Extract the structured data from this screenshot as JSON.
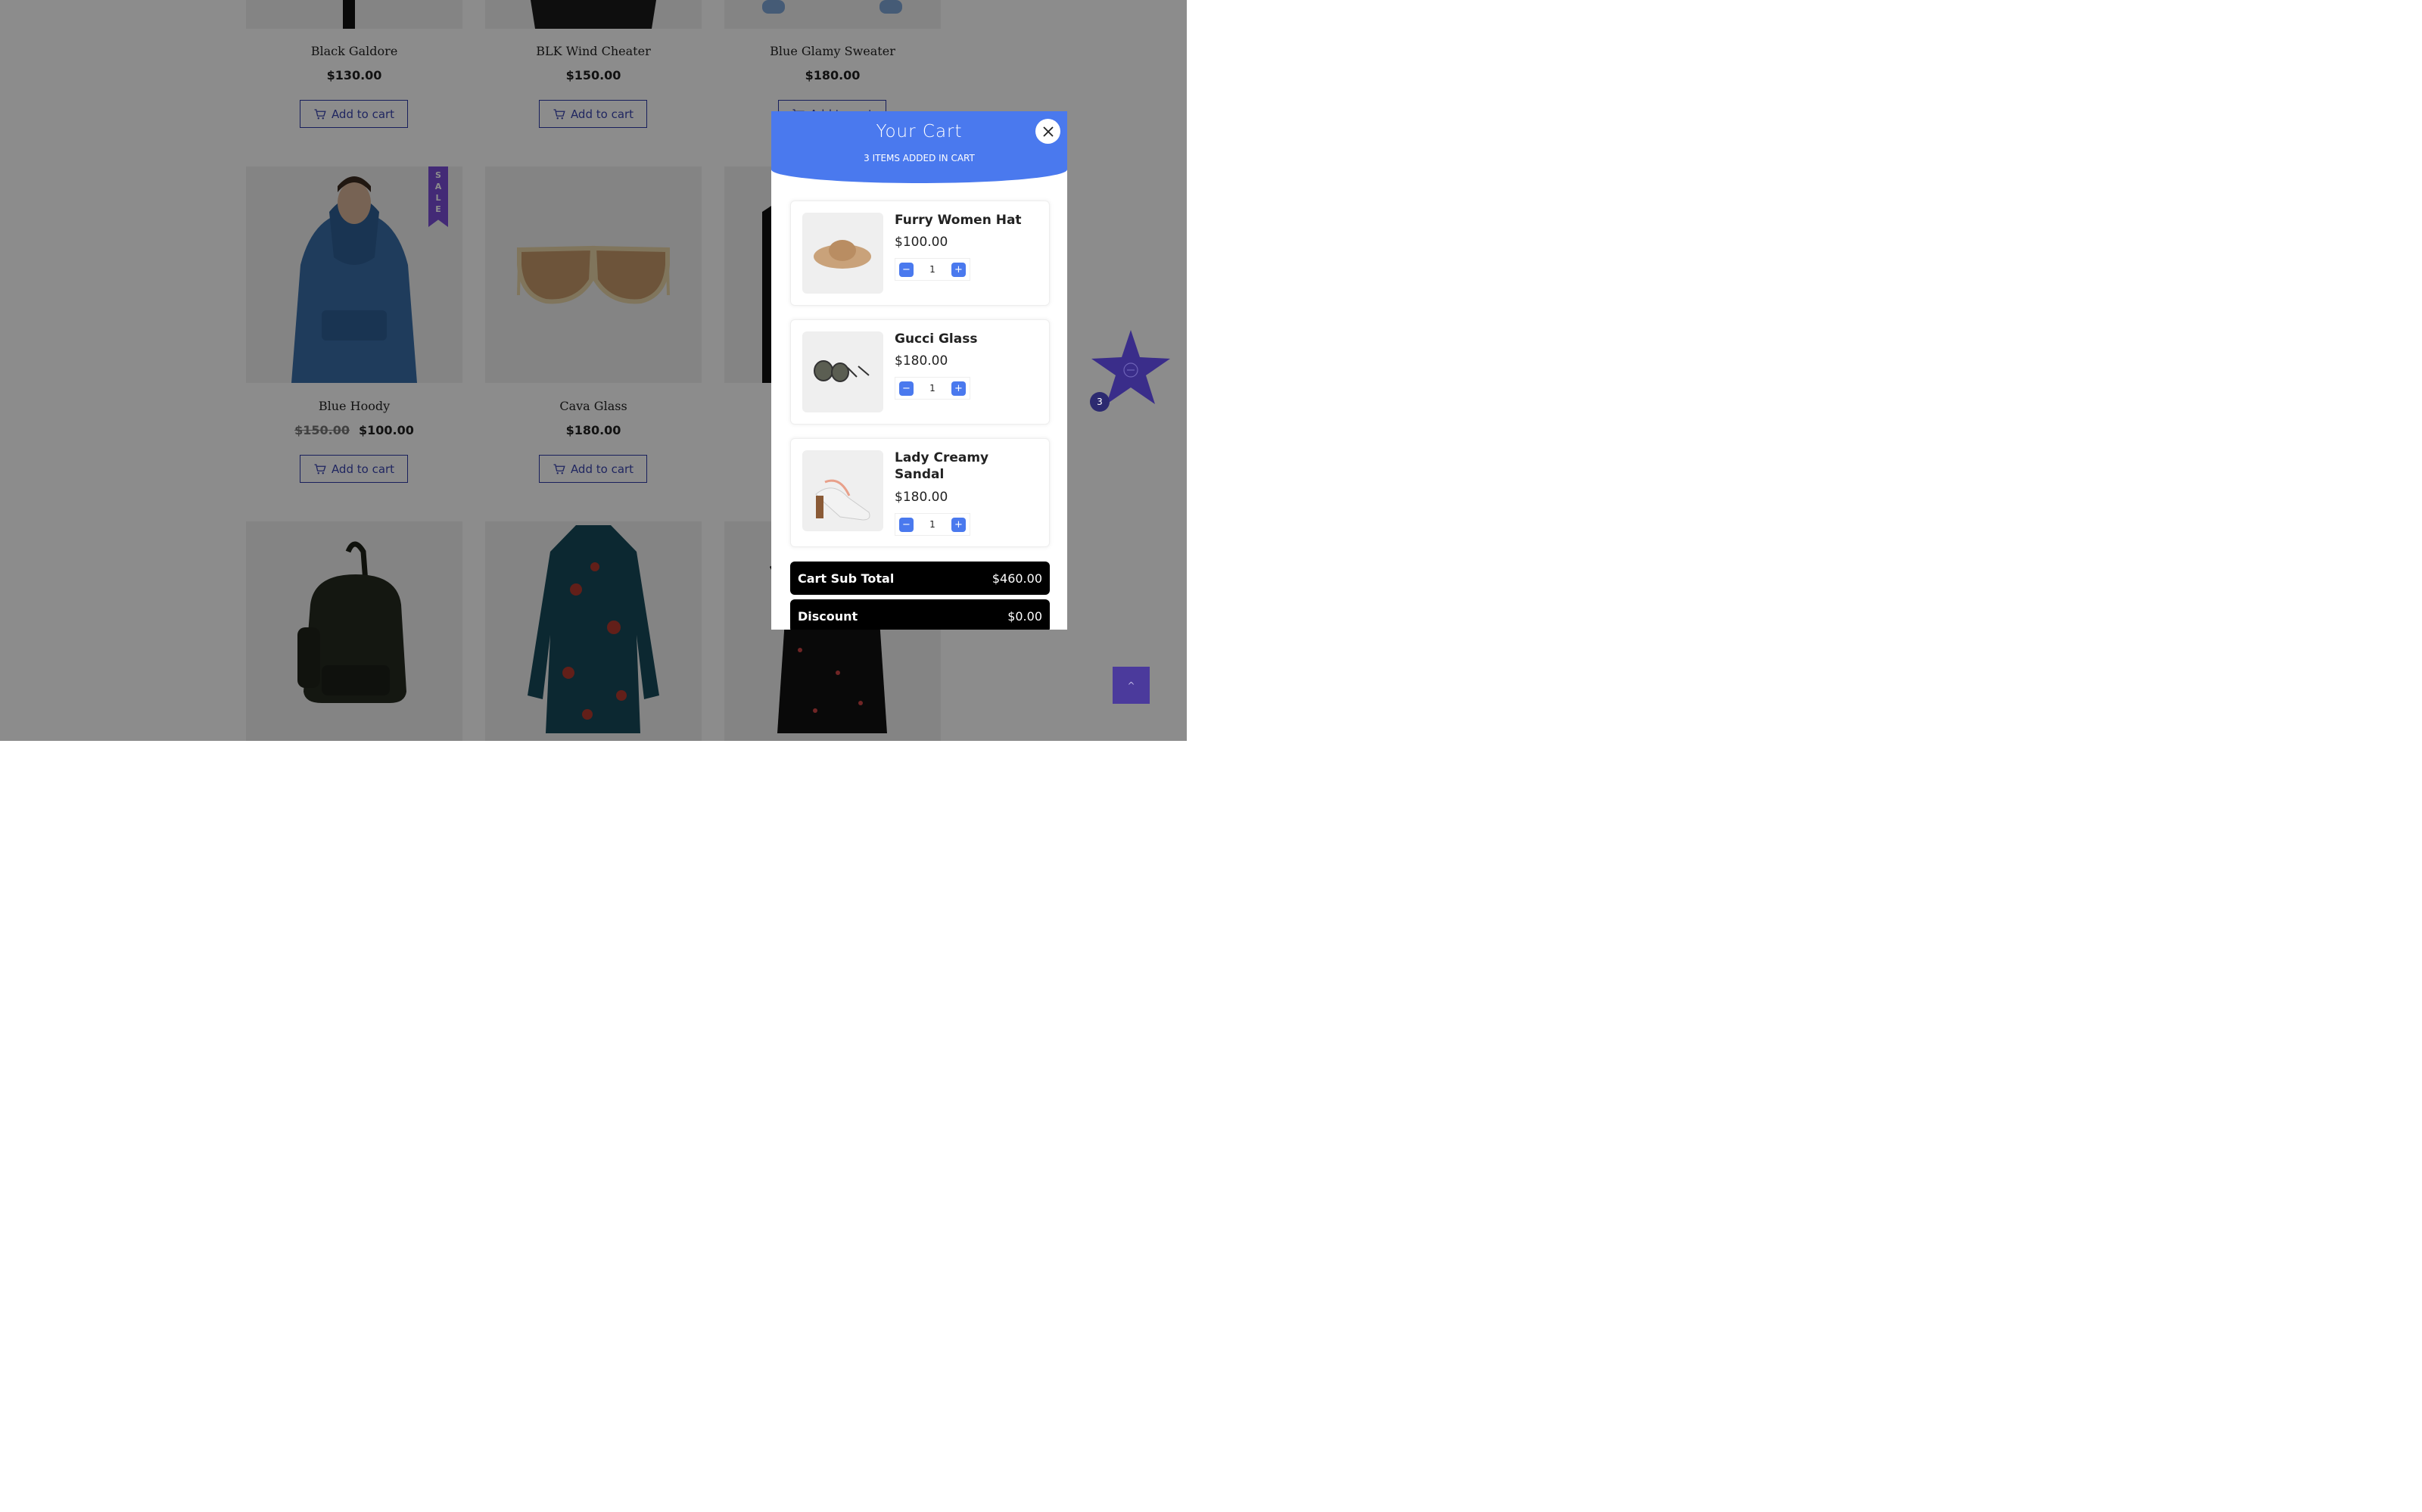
{
  "products": [
    {
      "name": "Black Galdore",
      "price": "$130.00",
      "button": "Add to cart"
    },
    {
      "name": "BLK Wind Cheater",
      "price": "$150.00",
      "button": "Add to cart"
    },
    {
      "name": "Blue Glamy Sweater",
      "price": "$180.00",
      "button": "Add to cart"
    },
    {
      "name": "Blue Hoody",
      "old_price": "$150.00",
      "price": "$100.00",
      "button": "Add to cart",
      "badge": [
        "S",
        "A",
        "L",
        "E"
      ]
    },
    {
      "name": "Cava Glass",
      "price": "$180.00",
      "button": "Add to cart"
    }
  ],
  "cart": {
    "title": "Your Cart",
    "subtitle": "3 ITEMS ADDED IN CART",
    "close_icon": "close-icon",
    "items": [
      {
        "name": "Furry Women Hat",
        "price": "$100.00",
        "qty": "1",
        "minus": "−",
        "plus": "+"
      },
      {
        "name": "Gucci Glass",
        "price": "$180.00",
        "qty": "1",
        "minus": "−",
        "plus": "+"
      },
      {
        "name": "Lady Creamy Sandal",
        "price": "$180.00",
        "qty": "1",
        "minus": "−",
        "plus": "+"
      }
    ],
    "subtotal": {
      "label": "Cart Sub Total",
      "value": "$460.00"
    },
    "discount": {
      "label": "Discount",
      "value": "$0.00"
    }
  },
  "floating": {
    "count": "3",
    "icon": "star-cart-icon"
  },
  "scroll_top": {
    "icon": "chevron-up-icon",
    "label": "^"
  },
  "colors": {
    "accent": "#4a79ee",
    "brand_purple": "#4b3a9c",
    "button_border": "#2d3aa8"
  }
}
